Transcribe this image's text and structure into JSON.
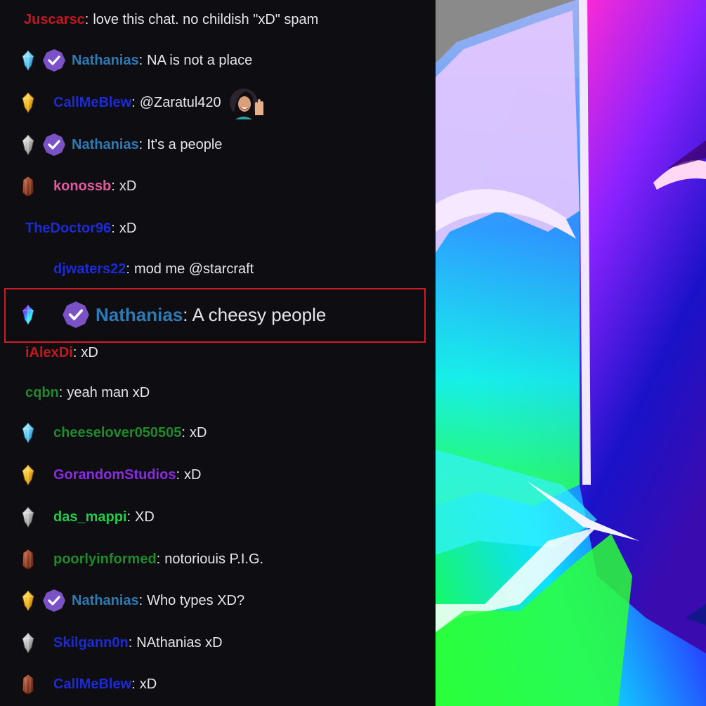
{
  "chat": {
    "messages": [
      {
        "user": "Juscarsc",
        "text": "love this chat. no childish \"xD\" spam",
        "user_color": "#c2191f"
      },
      {
        "user": "Nathanias",
        "text": "NA is not a place",
        "user_color": "#2e7ab5"
      },
      {
        "user": "CallMeBlew",
        "text": "@Zaratul420",
        "user_color": "#1c2bd4"
      },
      {
        "user": "Nathanias",
        "text": "It's a people",
        "user_color": "#2e7ab5"
      },
      {
        "user": "konossb",
        "text": "xD",
        "user_color": "#e05a9c"
      },
      {
        "user": "TheDoctor96",
        "text": "xD",
        "user_color": "#1c2bd4"
      },
      {
        "user": "djwaters22",
        "text": "mod me @starcraft",
        "user_color": "#1c2bd4"
      },
      {
        "user": "Nathanias",
        "text": "A cheesy people",
        "user_color": "#2e7ab5"
      },
      {
        "user": "iAlexDi",
        "text": "xD",
        "user_color": "#c2191f"
      },
      {
        "user": "cqbn",
        "text": "yeah man xD",
        "user_color": "#1f8a2a"
      },
      {
        "user": "cheeselover050505",
        "text": "xD",
        "user_color": "#1f8a2a"
      },
      {
        "user": "GorandomStudios",
        "text": "xD",
        "user_color": "#8a2be2"
      },
      {
        "user": "das_mappi",
        "text": "XD",
        "user_color": "#22c94a"
      },
      {
        "user": "poorlyinformed",
        "text": "notoriouis P.I.G.",
        "user_color": "#1f8a2a"
      },
      {
        "user": "Nathanias",
        "text": "Who types XD?",
        "user_color": "#2e7ab5"
      },
      {
        "user": "Skilgann0n",
        "text": "NAthanias xD",
        "user_color": "#1c2bd4"
      },
      {
        "user": "CallMeBlew",
        "text": "xD",
        "user_color": "#1c2bd4"
      }
    ],
    "separator": ":",
    "icons": {
      "gem_badge": "gem-badge-icon",
      "verified_badge": "verified-badge-icon",
      "wave_emote": "wave-emote-icon"
    }
  },
  "colors": {
    "chat_bg": "#0e0d12",
    "message_text": "#e6e6ea",
    "highlight_border": "#d21a24",
    "verified_purple": "#7b52c6"
  }
}
